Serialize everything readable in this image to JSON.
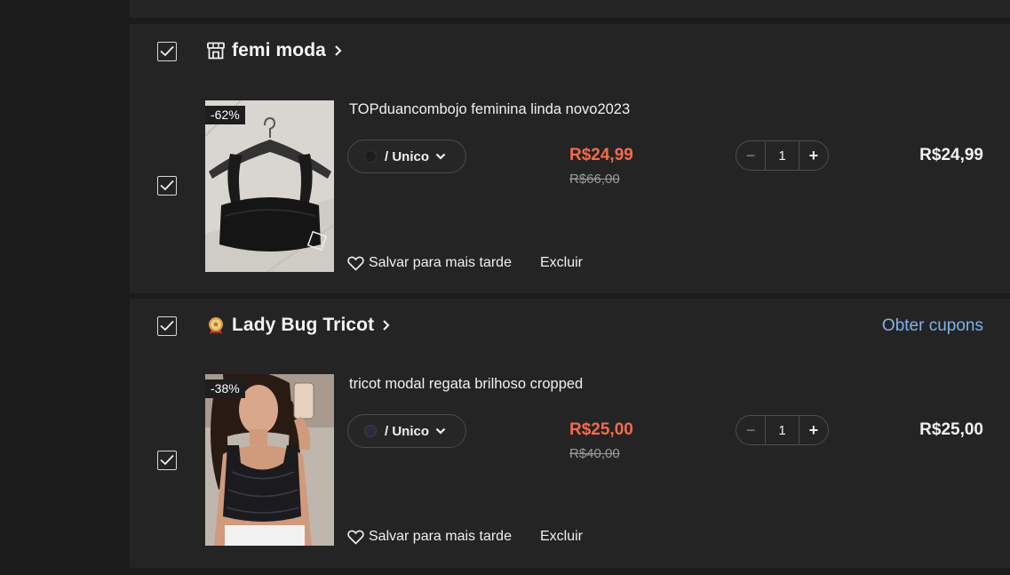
{
  "stores": [
    {
      "name": "femi moda",
      "icon": "store-icon",
      "item": {
        "title": "TOPduancombojo feminina linda novo2023",
        "discount": "-62%",
        "variant_label": "/ Unico",
        "price": "R$24,99",
        "old_price": "R$66,00",
        "quantity": "1",
        "total": "R$24,99",
        "save_label": "Salvar para mais tarde",
        "delete_label": "Excluir"
      }
    },
    {
      "name": "Lady Bug Tricot",
      "icon": "badge-medal-icon",
      "coupon_label": "Obter cupons",
      "item": {
        "title": "tricot modal regata brilhoso cropped",
        "discount": "-38%",
        "variant_label": "/ Unico",
        "price": "R$25,00",
        "old_price": "R$40,00",
        "quantity": "1",
        "total": "R$25,00",
        "save_label": "Salvar para mais tarde",
        "delete_label": "Excluir"
      }
    }
  ],
  "colors": {
    "background": "#1b1b1b",
    "panel": "#242424",
    "price": "#f56b4b",
    "coupon_link": "#7fb3e6"
  }
}
